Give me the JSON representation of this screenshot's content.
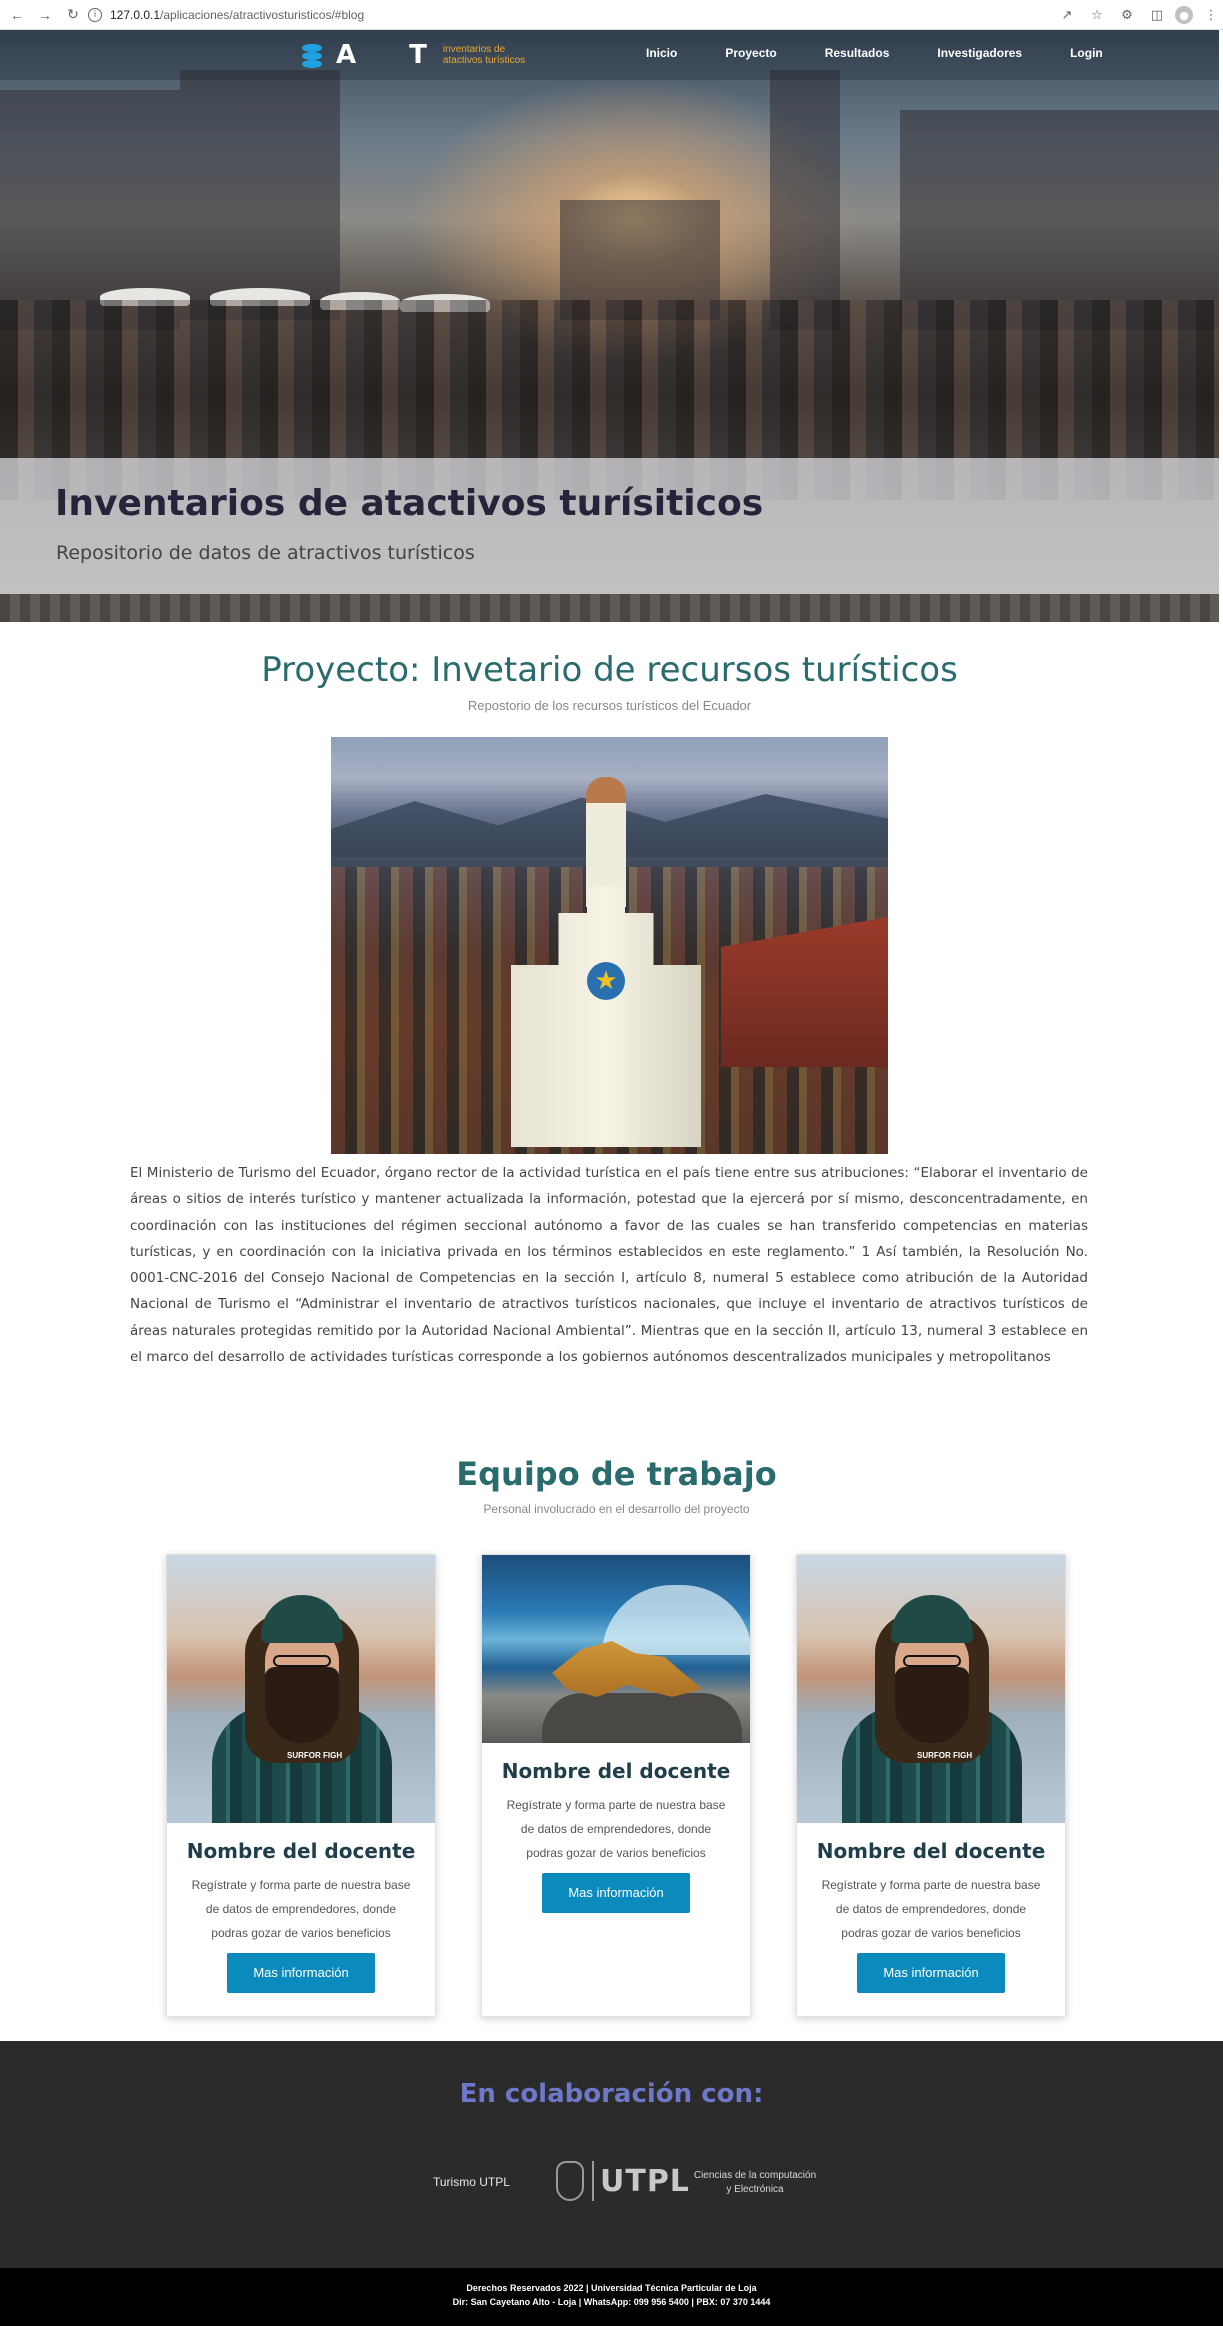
{
  "browser": {
    "url_host": "127.0.0.1",
    "url_path": "/aplicaciones/atractivosturisticos/#blog"
  },
  "header": {
    "logo_letters": "A T",
    "logo_tagline": "inventarios de atactivos turísticos",
    "nav": [
      "Inicio",
      "Proyecto",
      "Resultados",
      "Investigadores",
      "Login"
    ]
  },
  "hero": {
    "title": "Inventarios de atactivos turísiticos",
    "subtitle": "Repositorio de datos de atractivos turísticos"
  },
  "project": {
    "title": "Proyecto: Invetario de recursos turísticos",
    "subtitle": "Repostorio de los recursos turísticos del Ecuador",
    "body": "El Ministerio de Turismo del Ecuador, órgano rector de la actividad turística en el país tiene entre sus atribuciones: “Elaborar el inventario de áreas o sitios de interés turístico y mantener actualizada la información, potestad que la ejercerá por sí mismo, desconcentradamente, en coordinación con las instituciones del régimen seccional autónomo a favor de las cuales se han transferido competencias en materias turísticas, y en coordinación con la iniciativa privada en los términos establecidos en este reglamento.” 1 Así también, la Resolución No. 0001-CNC-2016 del Consejo Nacional de Competencias en la sección I, artículo 8, numeral 5 establece como atribución de la Autoridad Nacional de Turismo el “Administrar el inventario de atractivos turísticos nacionales, que incluye el inventario de atractivos turísticos de áreas naturales protegidas remitido por la Autoridad Nacional Ambiental”. Mientras que en la sección II, artículo 13, numeral 3 establece en el marco del desarrollo de actividades turísticas corresponde a los gobiernos autónomos descentralizados municipales y metropolitanos"
  },
  "team": {
    "title": "Equipo de trabajo",
    "subtitle": "Personal involucrado en el desarrollo del proyecto",
    "cards": [
      {
        "name": "Nombre del docente",
        "description": "Regístrate y forma parte de nuestra base de datos de emprendedores, donde podras gozar de varios beneficios",
        "button": "Mas información",
        "shirt_text": "SURFOR FIGH"
      },
      {
        "name": "Nombre del docente",
        "description": "Regístrate y forma parte de nuestra base de datos de emprendedores, donde podras gozar de varios beneficios",
        "button": "Mas información"
      },
      {
        "name": "Nombre del docente",
        "description": "Regístrate y forma parte de nuestra base de datos de emprendedores, donde podras gozar de varios beneficios",
        "button": "Mas información",
        "shirt_text": "SURFOR FIGH"
      }
    ]
  },
  "collaboration": {
    "title": "En colaboración con:",
    "partner_left": "Turismo UTPL",
    "partner_center": "UTPL",
    "partner_right": "Ciencias de la computación y Electrónica"
  },
  "footer": {
    "line1": "Derechos Reservados 2022 | Universidad Técnica Particular de Loja",
    "line2": "Dir: San Cayetano Alto - Loja | WhatsApp: 099 956 5400 | PBX: 07 370 1444"
  },
  "colors": {
    "accent_teal": "#2a6b6e",
    "button_blue": "#0b8bbd",
    "collab_title": "#6f78c8",
    "footer_bg": "#2b2b2b"
  }
}
